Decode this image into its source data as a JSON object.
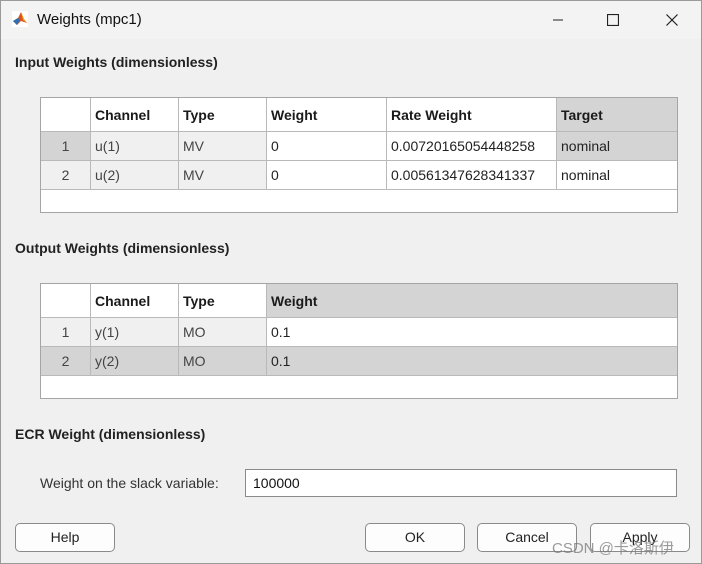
{
  "window": {
    "title": "Weights (mpc1)"
  },
  "input_weights": {
    "title": "Input Weights (dimensionless)",
    "headers": [
      "",
      "Channel",
      "Type",
      "Weight",
      "Rate Weight",
      "Target"
    ],
    "rows": [
      [
        "1",
        "u(1)",
        "MV",
        "0",
        "0.00720165054448258",
        "nominal"
      ],
      [
        "2",
        "u(2)",
        "MV",
        "0",
        "0.00561347628341337",
        "nominal"
      ]
    ]
  },
  "output_weights": {
    "title": "Output Weights (dimensionless)",
    "headers": [
      "",
      "Channel",
      "Type",
      "Weight"
    ],
    "rows": [
      [
        "1",
        "y(1)",
        "MO",
        "0.1"
      ],
      [
        "2",
        "y(2)",
        "MO",
        "0.1"
      ]
    ]
  },
  "ecr": {
    "title": "ECR Weight (dimensionless)",
    "label": "Weight on the slack variable:",
    "value": "100000"
  },
  "buttons": {
    "help": "Help",
    "ok": "OK",
    "cancel": "Cancel",
    "apply": "Apply"
  },
  "watermark": "CSDN @卡洛斯伊",
  "colors": {
    "selected_cell": "#d4d4d4",
    "readonly_cell": "#f0f0f0",
    "window_bg": "#f0f0f0"
  }
}
